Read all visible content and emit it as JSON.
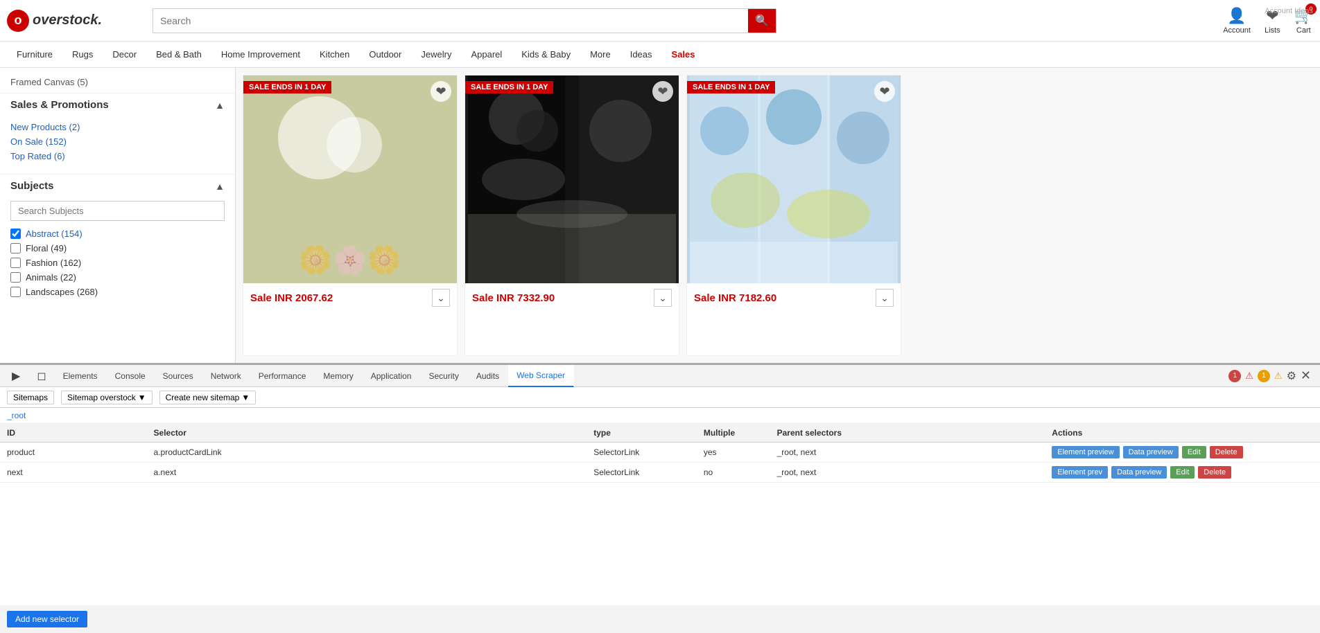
{
  "header": {
    "logo_text": "overstock.",
    "search_placeholder": "Search",
    "account_label": "Account",
    "lists_label": "Lists",
    "cart_label": "Cart",
    "cart_count": "0"
  },
  "navbar": {
    "items": [
      {
        "label": "Furniture",
        "active": false
      },
      {
        "label": "Rugs",
        "active": false
      },
      {
        "label": "Decor",
        "active": false
      },
      {
        "label": "Bed & Bath",
        "active": false
      },
      {
        "label": "Home Improvement",
        "active": false
      },
      {
        "label": "Kitchen",
        "active": false
      },
      {
        "label": "Outdoor",
        "active": false
      },
      {
        "label": "Jewelry",
        "active": false
      },
      {
        "label": "Apparel",
        "active": false
      },
      {
        "label": "Kids & Baby",
        "active": false
      },
      {
        "label": "More",
        "active": false
      },
      {
        "label": "Ideas",
        "active": false
      },
      {
        "label": "Sales",
        "active": true,
        "red": true
      }
    ]
  },
  "sidebar": {
    "framed_canvas": "Framed Canvas (5)",
    "sales_section": "Sales & Promotions",
    "promo_items": [
      {
        "label": "New Products (2)"
      },
      {
        "label": "On Sale (152)"
      },
      {
        "label": "Top Rated (6)"
      }
    ],
    "subjects_section": "Subjects",
    "search_subjects_placeholder": "Search Subjects",
    "subject_items": [
      {
        "label": "Abstract (154)",
        "checked": true
      },
      {
        "label": "Floral (49)",
        "checked": false
      },
      {
        "label": "Fashion (162)",
        "checked": false
      },
      {
        "label": "Animals (22)",
        "checked": false
      },
      {
        "label": "Landscapes (268)",
        "checked": false
      }
    ]
  },
  "products": [
    {
      "sale_badge": "SALE ENDS IN 1 DAY",
      "price": "Sale INR 2067.62",
      "img_type": "flowers"
    },
    {
      "sale_badge": "SALE ENDS IN 1 DAY",
      "price": "Sale INR 7332.90",
      "img_type": "dark-art"
    },
    {
      "sale_badge": "SALE ENDS IN 1 DAY",
      "price": "Sale INR 7182.60",
      "img_type": "blue-art"
    }
  ],
  "devtools": {
    "tabs": [
      {
        "label": "Elements"
      },
      {
        "label": "Console"
      },
      {
        "label": "Sources"
      },
      {
        "label": "Network"
      },
      {
        "label": "Performance"
      },
      {
        "label": "Memory"
      },
      {
        "label": "Application"
      },
      {
        "label": "Security"
      },
      {
        "label": "Audits"
      },
      {
        "label": "Web Scraper",
        "active": true
      }
    ],
    "error_count": "1",
    "warn_count": "1",
    "toolbar": {
      "sitemaps": "Sitemaps",
      "sitemap_overstock": "Sitemap overstock",
      "create_new_sitemap": "Create new sitemap"
    },
    "breadcrumb": "_root",
    "table": {
      "headers": [
        "ID",
        "Selector",
        "type",
        "Multiple",
        "Parent selectors",
        "Actions"
      ],
      "rows": [
        {
          "id": "product",
          "selector": "a.productCardLink",
          "type": "SelectorLink",
          "multiple": "yes",
          "parent_selectors": "_root, next",
          "actions": [
            "Element preview",
            "Data preview",
            "Edit",
            "Delete"
          ]
        },
        {
          "id": "next",
          "selector": "a.next",
          "type": "SelectorLink",
          "multiple": "no",
          "parent_selectors": "_root, next",
          "actions": [
            "Element prev",
            "Data preview",
            "Edit",
            "Delete"
          ]
        }
      ]
    },
    "add_selector_label": "Add new selector"
  },
  "account_ideas": "Account Ideas"
}
